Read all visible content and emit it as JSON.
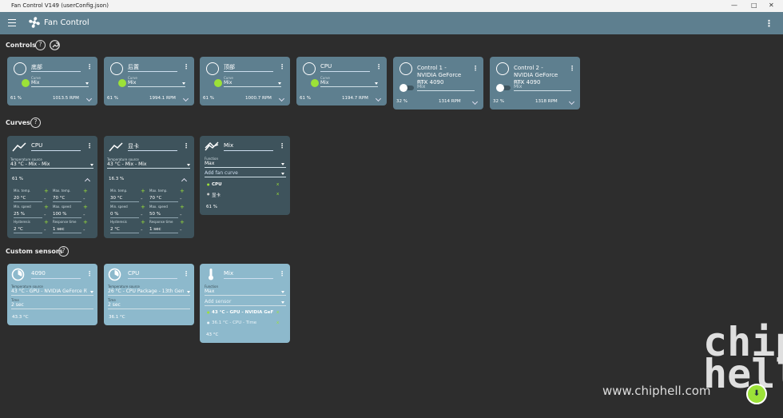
{
  "window": {
    "title": "Fan Control V149 (userConfig.json)",
    "min": "—",
    "max": "□",
    "close": "✕"
  },
  "appbar": {
    "title": "Fan Control",
    "menu": "⋮"
  },
  "sections": {
    "controls": "Controls",
    "curves": "Curves",
    "sensors": "Custom sensors",
    "help": "?"
  },
  "controls": [
    {
      "name": "底部",
      "label": "Curve",
      "curve": "Mix",
      "percent": "61 %",
      "rpm": "1013.5 RPM",
      "enabled": true
    },
    {
      "name": "后置",
      "label": "Curve",
      "curve": "Mix",
      "percent": "61 %",
      "rpm": "1994.1 RPM",
      "enabled": true
    },
    {
      "name": "顶部",
      "label": "Curve",
      "curve": "Mix",
      "percent": "61 %",
      "rpm": "1000.7 RPM",
      "enabled": true
    },
    {
      "name": "CPU",
      "label": "Curve",
      "curve": "Mix",
      "percent": "61 %",
      "rpm": "1194.7 RPM",
      "enabled": true
    },
    {
      "name": "Control 1 - NVIDIA GeForce RTX 4090",
      "label": "Curve",
      "curve": "Mix",
      "percent": "32 %",
      "rpm": "1314 RPM",
      "enabled": false
    },
    {
      "name": "Control 2 - NVIDIA GeForce RTX 4090",
      "label": "Curve",
      "curve": "Mix",
      "percent": "32 %",
      "rpm": "1318 RPM",
      "enabled": false
    }
  ],
  "curves": [
    {
      "name": "CPU",
      "src_label": "Temperature source",
      "src": "43 °C - Mix - Mix",
      "pct": "61 %",
      "labels": {
        "min_temp": "Min. temp.",
        "max_temp": "Max. temp.",
        "min_speed": "Min. speed",
        "max_speed": "Max. speed",
        "hyst": "Hysteresis",
        "resp": "Response time"
      },
      "min_temp": "20 °C",
      "max_temp": "70 °C",
      "min_speed": "25 %",
      "max_speed": "100 %",
      "hyst": "2 °C",
      "resp": "1 sec"
    },
    {
      "name": "显卡",
      "src_label": "Temperature source",
      "src": "43 °C - Mix - Mix",
      "pct": "16.3 %",
      "labels": {
        "min_temp": "Min. temp.",
        "max_temp": "Max. temp.",
        "min_speed": "Min. speed",
        "max_speed": "Max. speed",
        "hyst": "Hysteresis",
        "resp": "Response time"
      },
      "min_temp": "30 °C",
      "max_temp": "70 °C",
      "min_speed": "0 %",
      "max_speed": "50 %",
      "hyst": "2 °C",
      "resp": "1 sec"
    }
  ],
  "mix_curve": {
    "name": "Mix",
    "fn_label": "Function",
    "fn": "Max",
    "add": "Add fan curve",
    "items": [
      "CPU",
      "显卡"
    ],
    "remove": "x",
    "pct": "61 %"
  },
  "sensors": [
    {
      "name": "4090",
      "src_label": "Temperature source",
      "src": "43 °C - GPU - NVIDIA GeForce RTX",
      "time_label": "Time",
      "time": "2 sec",
      "value": "43.3 °C"
    },
    {
      "name": "CPU",
      "src_label": "Temperature source",
      "src": "26 °C - CPU Package - 13th Gen I",
      "time_label": "Time",
      "time": "2 sec",
      "value": "36.1 °C"
    }
  ],
  "mix_sensor": {
    "name": "Mix",
    "fn_label": "Function",
    "fn": "Max",
    "add": "Add sensor",
    "items": [
      "43 °C - GPU - NVIDIA GeF",
      "36.1 °C - CPU - Time"
    ],
    "value": "43 °C"
  },
  "pm": {
    "plus": "+",
    "minus": "-"
  },
  "watermark": "www.chiphell.com",
  "chip": "chip\nhell"
}
